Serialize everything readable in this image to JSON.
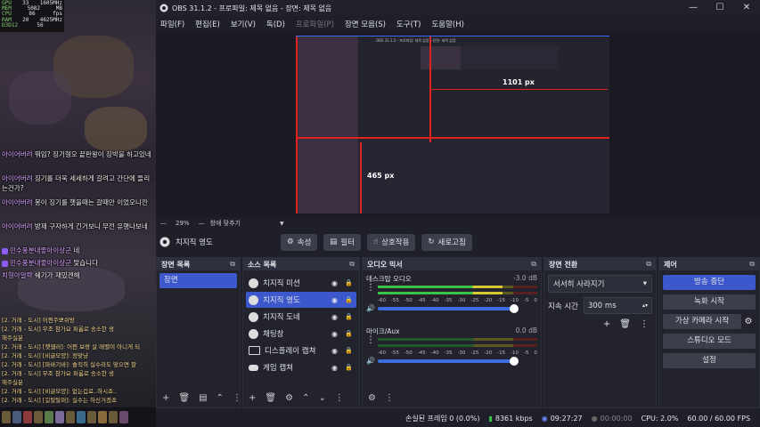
{
  "hud": {
    "rows": [
      {
        "k": "GPU",
        "v1": "33",
        "v2": "1605MHz"
      },
      {
        "k": "MEM",
        "v1": "5082",
        "v2": "MB"
      },
      {
        "k": "CPU",
        "v1": "86",
        "v2": "fps"
      },
      {
        "k": "RAM",
        "v1": "20",
        "v2": "4625MHz"
      },
      {
        "k": "D3D12",
        "v1": "56",
        "v2": ""
      }
    ]
  },
  "chat": [
    {
      "user": "아이어버려",
      "text": " 뭐임? 징기형오 끝판왕이 징박을 하고있네"
    },
    {
      "user": "아이어버려",
      "text": " 징기를 더욱 세세하게 갈려고 간단에 들리는건가?"
    },
    {
      "user": "아이어버려",
      "text": " 봉이 징기를 햇을때는 갈때만 이었오니깐"
    },
    {
      "user": "아이어버려",
      "text": " 방제 구자하게 긴거보니 무전 유행나보네"
    },
    {
      "user": "민수풍분내좋아이상군",
      "text": " 네",
      "badge": true
    },
    {
      "user": "민수풍분내좋아이상군",
      "text": " 맞습니다",
      "badge": true
    },
    {
      "user": "치형아알락",
      "text": " 쉐기가 재밌겐해"
    }
  ],
  "log": [
    "[2. 거래 - 도시] 어쩐주뽀쉬방",
    "[2. 거래 - 도시] 무조 참가요 퍼롬로 송소한 생",
    "   해주실분",
    "[2. 거래 - 도시] [햇웹러]: 어쩐 보랑 살 레벨이 아니게 되",
    "[2. 거래 - 도시] [비글모양]: 정맞냥",
    "[2. 거래 - 도시] [파바기바]: 솔직히 실수라도 맞으면 잘",
    "[2. 거래 - 도시] 무조 참가요 퍼롬로 송소한 생",
    "   해주실분",
    "[2. 거래 - 도시] [비글모양]: 없는겁료..하시죠..",
    "[2. 거래 - 도시] [길탈탈퍼]: 실수는 하신거겠죠"
  ],
  "window": {
    "title": "OBS 31.1.2 - 프로파일: 제목 없음 - 장면: 제목 없음",
    "minimize": "—",
    "maximize": "☐",
    "close": "✕"
  },
  "menu": [
    {
      "label": "파일(F)"
    },
    {
      "label": "편집(E)"
    },
    {
      "label": "보기(V)"
    },
    {
      "label": "독(D)"
    },
    {
      "label": "프로파일(P)",
      "disabled": true
    },
    {
      "label": "장면 모음(S)"
    },
    {
      "label": "도구(T)"
    },
    {
      "label": "도움말(H)"
    }
  ],
  "preview": {
    "width_label": "1101 px",
    "height_label": "465 px",
    "inner_title": "OBS 31.1.2 - 프로파일: 제목 없음 - 장면: 제목 없음"
  },
  "zoom": {
    "percent": "29%",
    "fit": "창에 맞추기"
  },
  "toolbar": {
    "source_name": "치지직 영도",
    "properties": "속성",
    "filters": "필터",
    "interact": "상호작용",
    "refresh": "새로고침"
  },
  "scenes": {
    "title": "장면 목록",
    "items": [
      "장면"
    ]
  },
  "sources": {
    "title": "소스 목록",
    "items": [
      {
        "label": "치지직 미션",
        "icon": "globe-icon"
      },
      {
        "label": "치지직 영도",
        "icon": "globe-icon",
        "selected": true
      },
      {
        "label": "치지직 도네",
        "icon": "globe-icon"
      },
      {
        "label": "채팅창",
        "icon": "globe-icon"
      },
      {
        "label": "디스플레이 캡쳐",
        "icon": "monitor-icon"
      },
      {
        "label": "게임 캡쳐",
        "icon": "gamepad-icon"
      }
    ]
  },
  "mixer": {
    "title": "오디오 믹서",
    "channels": [
      {
        "name": "데스크탑 오디오",
        "db": "-3.0 dB",
        "level": 0.78,
        "volume": 0.98
      },
      {
        "name": "마이크/Aux",
        "db": "0.0 dB",
        "level": 0.0,
        "volume": 1.0
      }
    ],
    "scale": [
      "-60",
      "-55",
      "-50",
      "-45",
      "-40",
      "-35",
      "-30",
      "-25",
      "-20",
      "-15",
      "-10",
      "-5",
      "0"
    ]
  },
  "transitions": {
    "title": "장면 전환",
    "type": "서서히 사라지기",
    "duration_label": "지속 시간",
    "duration": "300 ms"
  },
  "controls": {
    "title": "제어",
    "stop_stream": "방송 중단",
    "start_recording": "녹화 시작",
    "virtual_camera": "가상 카메라 시작",
    "studio_mode": "스튜디오 모드",
    "settings": "설정"
  },
  "status": {
    "dropped": "손실된 프레임 0 (0.0%)",
    "bitrate": "8361 kbps",
    "live_time": "09:27:27",
    "rec_time": "00:00:00",
    "cpu": "CPU: 2.0%",
    "fps": "60.00 / 60.00 FPS"
  },
  "colors": {
    "accent": "#3c58cc",
    "rec_red": "#e02222",
    "meter_green": "#3ac24a",
    "meter_yellow": "#d6c735",
    "meter_red": "#c23a3a"
  }
}
